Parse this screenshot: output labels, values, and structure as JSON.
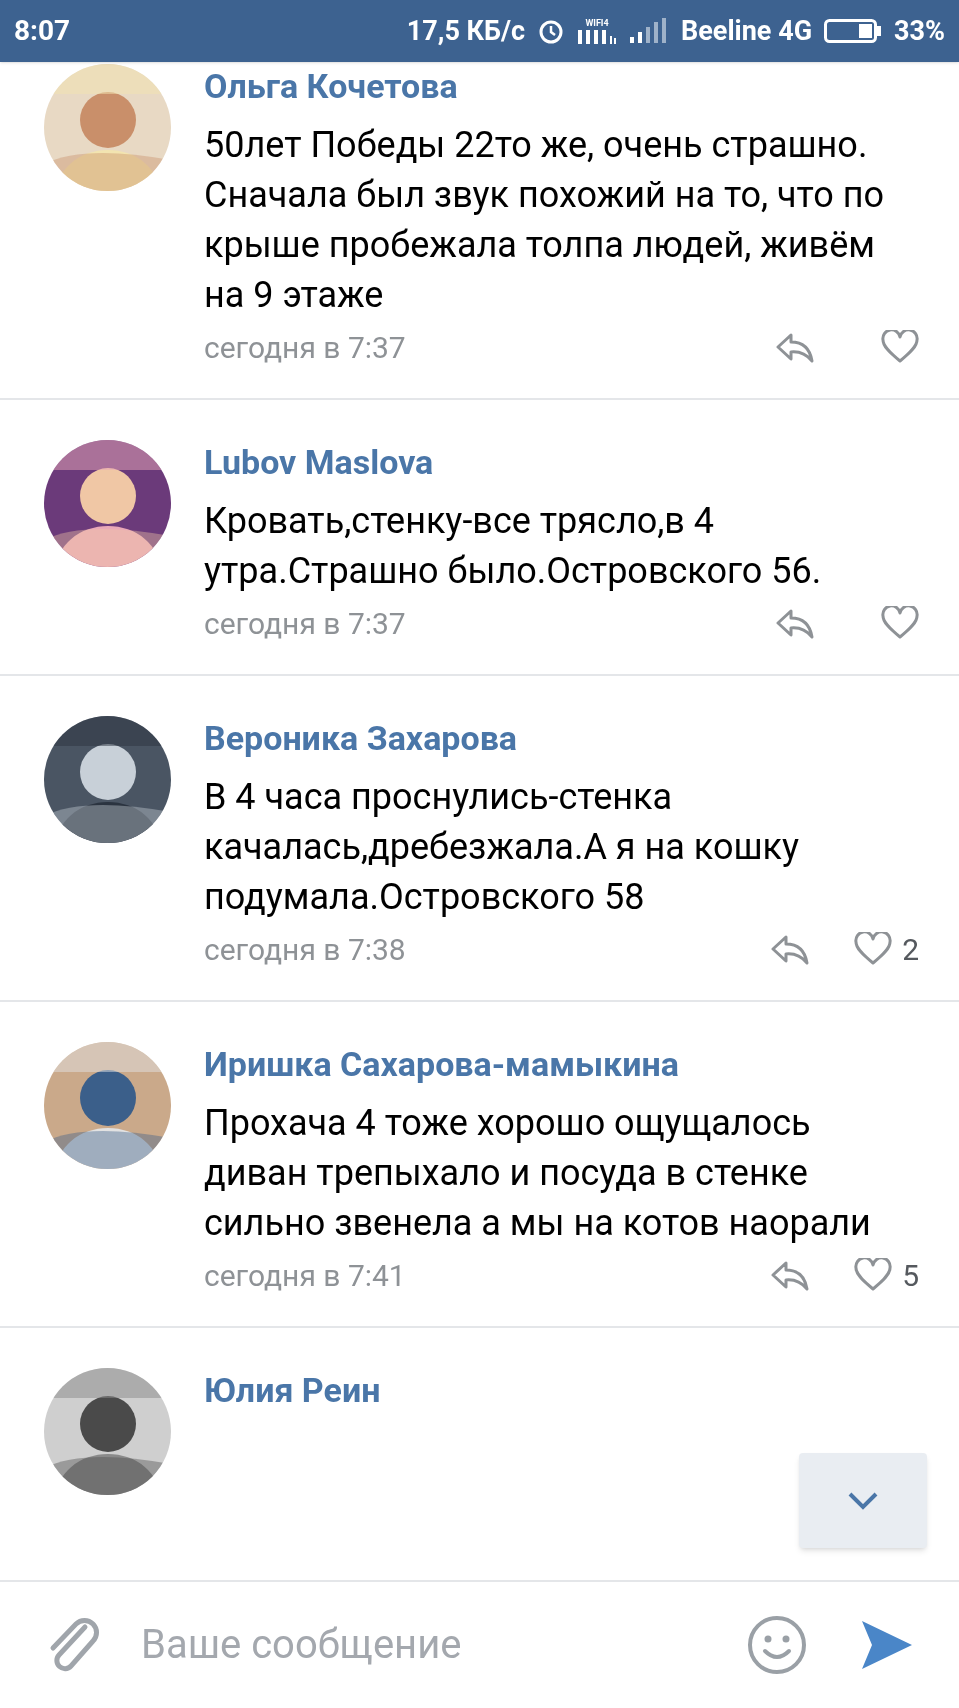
{
  "status_bar": {
    "time": "8:07",
    "speed": "17,5 КБ/с",
    "wifi_label": "WIFI4",
    "carrier": "Beeline 4G",
    "battery": "33%"
  },
  "comments": [
    {
      "author": "Ольга Кочетова",
      "text": "50лет Победы 22то же, очень страшно. Сначала был звук похожий на то, что по крыше пробежала толпа людей, живём на 9 этаже",
      "time": "сегодня в 7:37"
    },
    {
      "author": "Lubov Maslova",
      "text": "Кровать,стенку-все трясло,в 4 утра.Страшно было.Островского 56.",
      "time": "сегодня в 7:37"
    },
    {
      "author": "Вероника Захарова",
      "text": "В 4 часа проснулись-стенка качалась,дребезжала.А я на кошку подумала.Островского 58",
      "time": "сегодня в 7:38",
      "likes": "2"
    },
    {
      "author": "Иришка Сахарова-мамыкина",
      "text": "Прохача 4 тоже хорошо ощущалось диван трепыхало и посуда в стенке сильно звенела а мы на котов наорали",
      "time": "сегодня в 7:41",
      "likes": "5"
    },
    {
      "author": "Юлия Реин"
    }
  ],
  "composer": {
    "placeholder": "Ваше сообщение"
  }
}
